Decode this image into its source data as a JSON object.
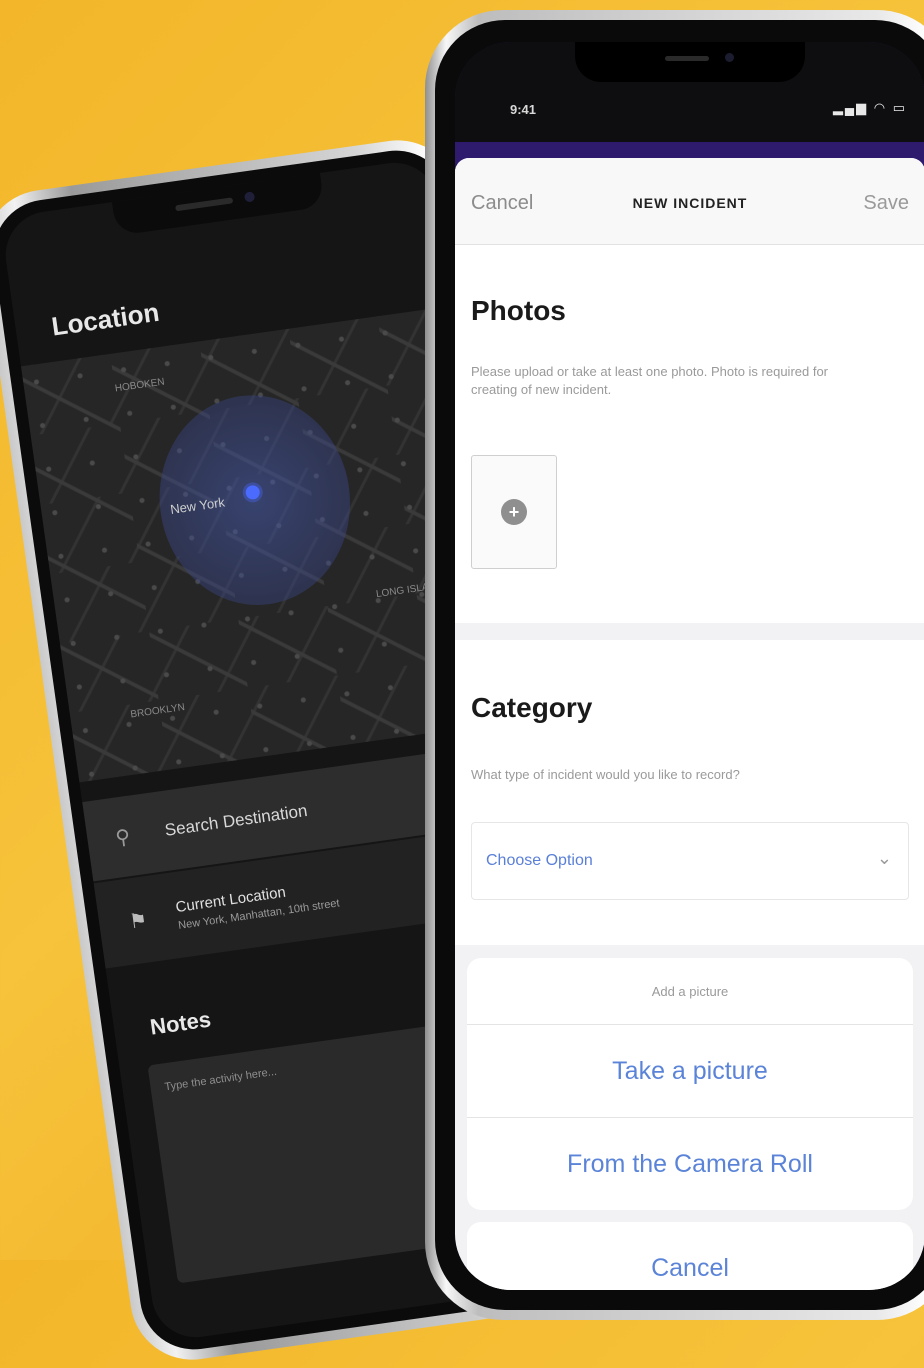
{
  "back_phone": {
    "location_title": "Location",
    "map": {
      "city_label": "New York",
      "minor_labels": [
        "HOBOKEN",
        "LONG ISLAND CITY",
        "BROOKLYN"
      ],
      "locate_icon": "crosshair-icon"
    },
    "search": {
      "icon": "search-icon",
      "placeholder": "Search Destination"
    },
    "current_location": {
      "icon": "pin-icon",
      "title": "Current Location",
      "subtitle": "New York, Manhattan, 10th street"
    },
    "notes_title": "Notes",
    "notes_placeholder": "Type the activity here..."
  },
  "front_phone": {
    "status": {
      "time": "9:41",
      "indicators": "signal wifi battery"
    },
    "nav": {
      "cancel": "Cancel",
      "title": "NEW INCIDENT",
      "save": "Save"
    },
    "photos": {
      "title": "Photos",
      "description": "Please upload or take at least one photo. Photo is required for creating of new incident.",
      "add_icon": "plus-icon"
    },
    "category": {
      "title": "Category",
      "question": "What type of incident would you like to record?",
      "select_value": "Choose Option",
      "select_icon": "chevron-icon"
    },
    "action_sheet": {
      "title": "Add a picture",
      "options": [
        "Take a picture",
        "From the Camera Roll"
      ],
      "cancel": "Cancel"
    }
  }
}
